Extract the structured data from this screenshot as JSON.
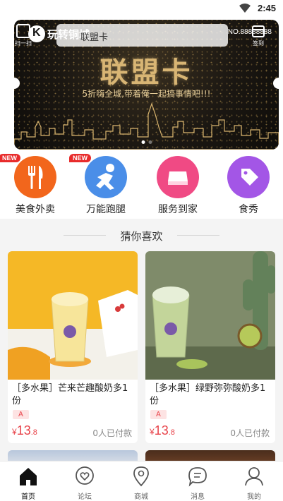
{
  "status_bar": {
    "time": "2:45"
  },
  "header": {
    "scan_label": "扫一扫",
    "logo_text": "玩转铜城",
    "search_text": "联盟卡",
    "sign_label": "签到"
  },
  "banner": {
    "title": "联盟卡",
    "slogan": "5折嗨全城,带着俺一起搞事情吧!!!",
    "card_number": "NO.88888888"
  },
  "categories": [
    {
      "label": "美食外卖",
      "badge": "NEW",
      "color": "#f2661c",
      "icon": "fork-knife-icon"
    },
    {
      "label": "万能跑腿",
      "badge": "NEW",
      "color": "#4a8ee8",
      "icon": "running-person-icon"
    },
    {
      "label": "服务到家",
      "badge": "",
      "color": "#f04a84",
      "icon": "home-service-icon"
    },
    {
      "label": "食秀",
      "badge": "",
      "color": "#a356e6",
      "icon": "tag-icon"
    }
  ],
  "section": {
    "title": "猜你喜欢"
  },
  "products": [
    {
      "name": "［多水果］芒来芒趣酸奶多1份",
      "tag": "A",
      "currency": "¥",
      "price_int": "13",
      "price_dec": ".8",
      "sold": "0人已付款"
    },
    {
      "name": "［多水果］绿野弥弥酸奶多1份",
      "tag": "A",
      "currency": "¥",
      "price_int": "13",
      "price_dec": ".8",
      "sold": "0人已付款"
    }
  ],
  "tabbar": [
    {
      "label": "首页",
      "icon": "home-icon",
      "active": true
    },
    {
      "label": "论坛",
      "icon": "forum-heart-icon",
      "active": false
    },
    {
      "label": "商城",
      "icon": "map-pin-icon",
      "active": false
    },
    {
      "label": "消息",
      "icon": "chat-icon",
      "active": false
    },
    {
      "label": "我的",
      "icon": "user-icon",
      "active": false
    }
  ]
}
